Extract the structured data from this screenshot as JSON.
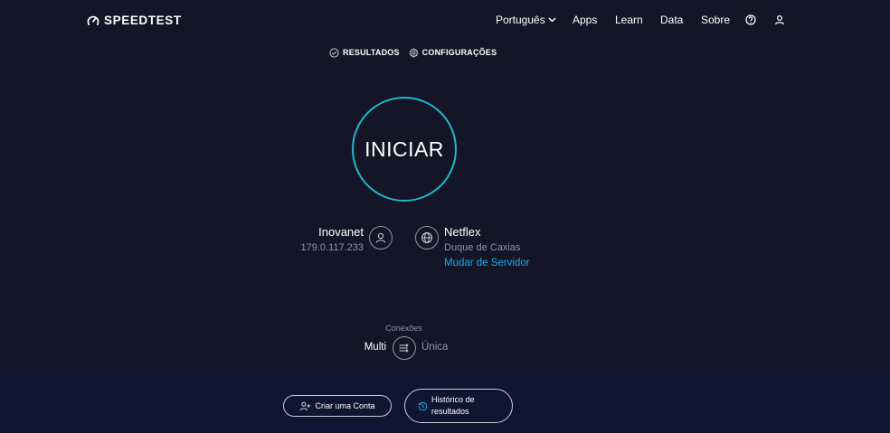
{
  "header": {
    "logo_text": "SPEEDTEST",
    "nav": {
      "language": "Português",
      "apps": "Apps",
      "learn": "Learn",
      "data": "Data",
      "about": "Sobre"
    }
  },
  "subnav": {
    "results": "RESULTADOS",
    "settings": "CONFIGURAÇÕES"
  },
  "go_button": {
    "label": "INICIAR"
  },
  "isp": {
    "name": "Inovanet",
    "ip": "179.0.117.233"
  },
  "server": {
    "name": "Netflex",
    "location": "Duque de Caxias",
    "change_label": "Mudar de Servidor"
  },
  "connections": {
    "label": "Conexões",
    "multi": "Multi",
    "single": "Única"
  },
  "footer": {
    "create_account": "Criar uma Conta",
    "history": "Histórico de resultados"
  },
  "colors": {
    "background": "#141526",
    "footer_bg": "#0f1533",
    "accent_ring": "#1fb8cd",
    "link": "#1fa9e4",
    "muted": "#9193a8"
  },
  "icons": [
    "speedometer-logo-icon",
    "chevron-down-icon",
    "help-icon",
    "user-icon",
    "check-circle-icon",
    "gear-icon",
    "person-icon",
    "globe-icon",
    "connections-icon",
    "add-user-icon",
    "history-icon"
  ]
}
